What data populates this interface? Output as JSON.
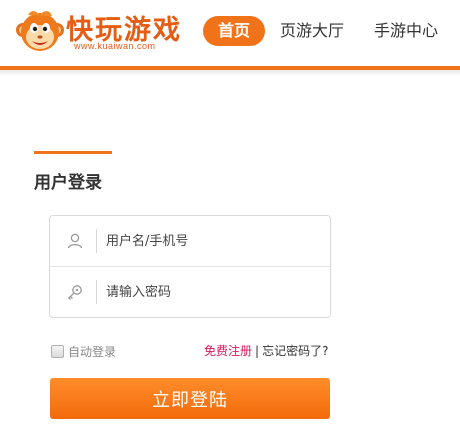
{
  "header": {
    "logo": {
      "title": "快玩游戏",
      "url": "www.kuaiwan.com",
      "mascot_icon": "monkey-mascot-icon"
    },
    "nav": [
      {
        "label": "首页",
        "active": true
      },
      {
        "label": "页游大厅",
        "active": false
      },
      {
        "label": "手游中心",
        "active": false
      }
    ]
  },
  "login": {
    "title": "用户登录",
    "username": {
      "placeholder": "用户名/手机号",
      "value": "",
      "icon": "user-icon"
    },
    "password": {
      "placeholder": "请输入密码",
      "value": "",
      "icon": "key-icon"
    },
    "remember": {
      "label": "自动登录",
      "checked": false
    },
    "register_link": "免费注册",
    "separator": "|",
    "forgot_link": "忘记密码了?",
    "submit_label": "立即登陆"
  },
  "colors": {
    "accent": "#f0731a",
    "register_link": "#d7185d",
    "button_top": "#ff8d2a",
    "button_bottom": "#f36a0c"
  }
}
